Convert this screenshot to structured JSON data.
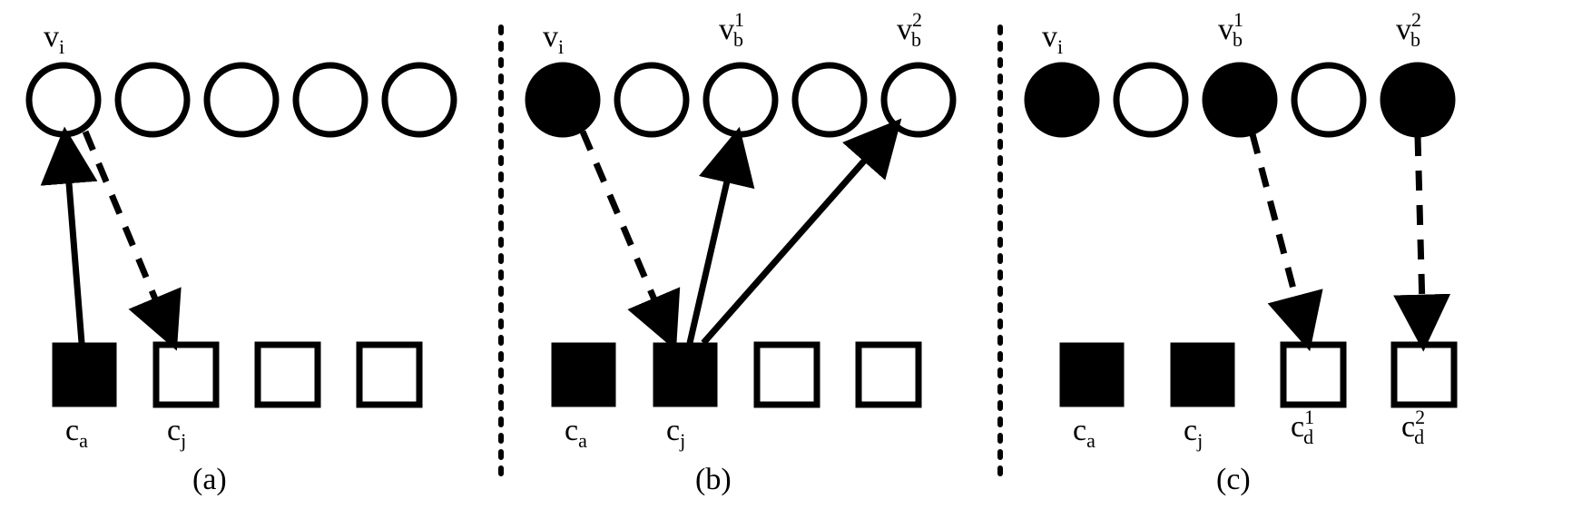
{
  "chart_data": [
    {
      "id": "panel-a",
      "caption": "(a)",
      "circles": [
        {
          "label": "v_i",
          "filled": false
        },
        {
          "label": "",
          "filled": false
        },
        {
          "label": "",
          "filled": false
        },
        {
          "label": "",
          "filled": false
        },
        {
          "label": "",
          "filled": false
        }
      ],
      "squares": [
        {
          "label": "c_a",
          "filled": true
        },
        {
          "label": "c_j",
          "filled": false
        },
        {
          "label": "",
          "filled": false
        },
        {
          "label": "",
          "filled": false
        }
      ],
      "arrows": [
        {
          "from": "c_a",
          "to": "v_i",
          "style": "solid",
          "dir": "up"
        },
        {
          "from": "v_i",
          "to": "c_j",
          "style": "dashed",
          "dir": "down"
        }
      ]
    },
    {
      "id": "panel-b",
      "caption": "(b)",
      "circles": [
        {
          "label": "v_i",
          "filled": true
        },
        {
          "label": "",
          "filled": false
        },
        {
          "label": "v_b^1",
          "filled": false
        },
        {
          "label": "",
          "filled": false
        },
        {
          "label": "v_b^2",
          "filled": false
        }
      ],
      "squares": [
        {
          "label": "c_a",
          "filled": true
        },
        {
          "label": "c_j",
          "filled": true
        },
        {
          "label": "",
          "filled": false
        },
        {
          "label": "",
          "filled": false
        }
      ],
      "arrows": [
        {
          "from": "v_i",
          "to": "c_j",
          "style": "dashed",
          "dir": "down"
        },
        {
          "from": "c_j",
          "to": "v_b^1",
          "style": "solid",
          "dir": "up"
        },
        {
          "from": "c_j",
          "to": "v_b^2",
          "style": "solid",
          "dir": "up"
        }
      ]
    },
    {
      "id": "panel-c",
      "caption": "(c)",
      "circles": [
        {
          "label": "v_i",
          "filled": true
        },
        {
          "label": "",
          "filled": false
        },
        {
          "label": "v_b^1",
          "filled": true
        },
        {
          "label": "",
          "filled": false
        },
        {
          "label": "v_b^2",
          "filled": true
        }
      ],
      "squares": [
        {
          "label": "c_a",
          "filled": true
        },
        {
          "label": "c_j",
          "filled": true
        },
        {
          "label": "c_d^1",
          "filled": false
        },
        {
          "label": "c_d^2",
          "filled": false
        }
      ],
      "arrows": [
        {
          "from": "v_b^1",
          "to": "c_d^1",
          "style": "dashed",
          "dir": "down"
        },
        {
          "from": "v_b^2",
          "to": "c_d^2",
          "style": "dashed",
          "dir": "down"
        }
      ]
    }
  ],
  "labels": {
    "a": {
      "v_i": "v",
      "c_a": "c",
      "c_j": "c",
      "cap": "(a)"
    },
    "b": {
      "v_i": "v",
      "v_b1": "v",
      "v_b2": "v",
      "c_a": "c",
      "c_j": "c",
      "cap": "(b)"
    },
    "c": {
      "v_i": "v",
      "v_b1": "v",
      "v_b2": "v",
      "c_a": "c",
      "c_j": "c",
      "c_d1": "c",
      "c_d2": "c",
      "cap": "(c)"
    },
    "sub_i": "i",
    "sub_a": "a",
    "sub_j": "j",
    "sub_b": "b",
    "sub_d": "d",
    "sup_1": "1",
    "sup_2": "2"
  }
}
